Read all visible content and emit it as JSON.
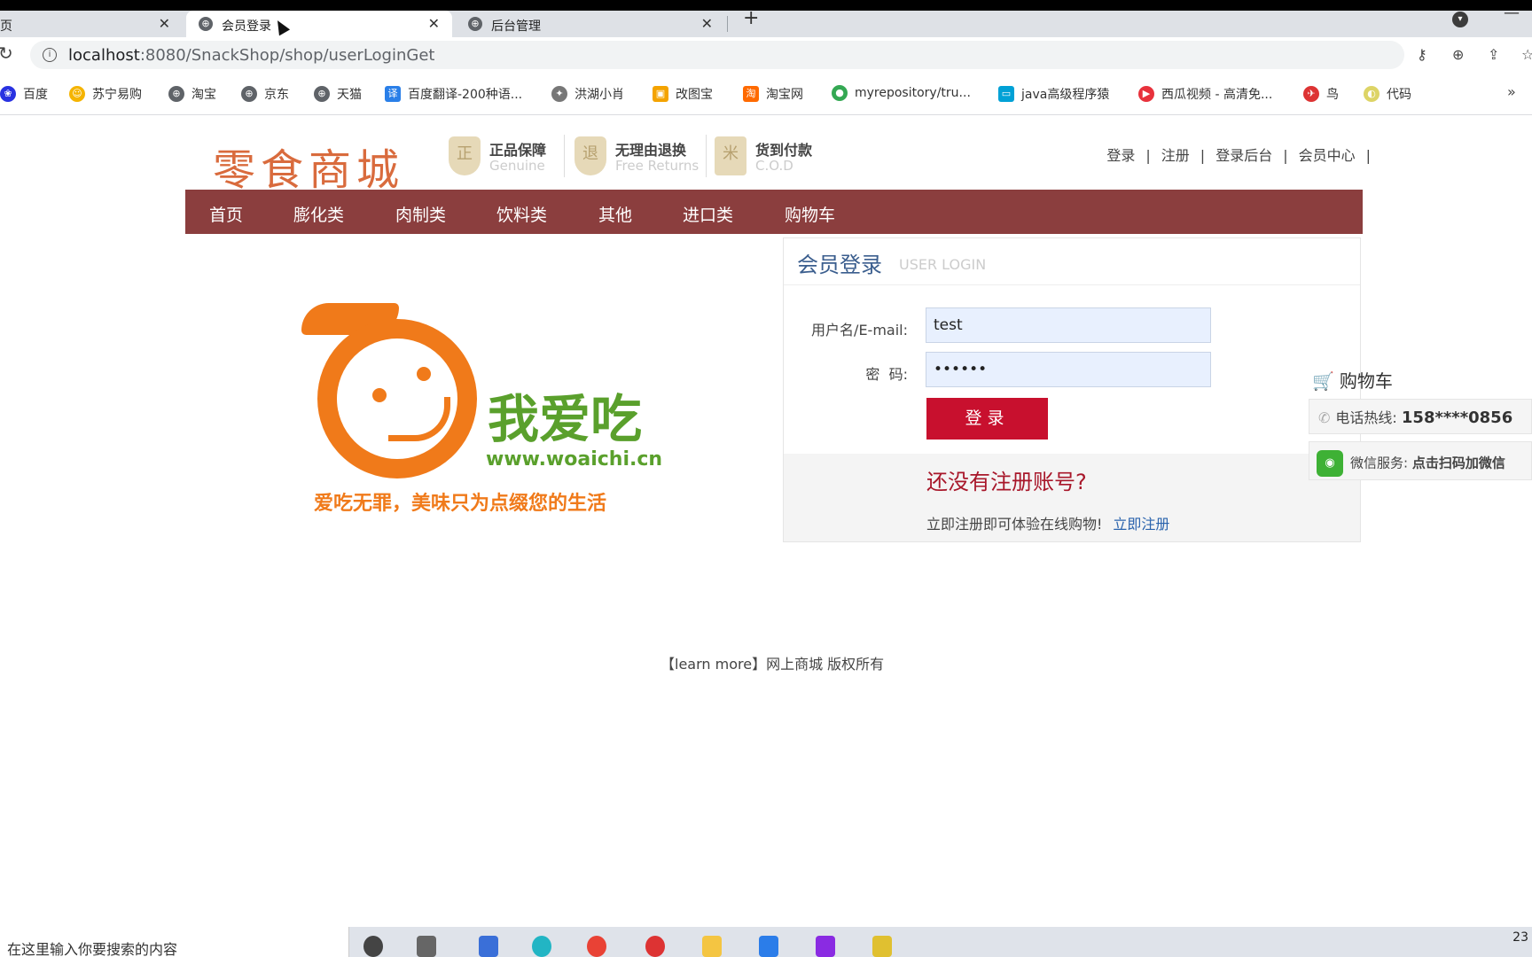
{
  "browser": {
    "tabs": [
      {
        "title": "页",
        "active": false
      },
      {
        "title": "会员登录",
        "active": true
      },
      {
        "title": "后台管理",
        "active": false
      }
    ],
    "url_host": "localhost",
    "url_path": ":8080/SnackShop/shop/userLoginGet",
    "bookmarks": [
      {
        "label": "百度",
        "icon": "baidu-icon",
        "color": "#2932e1"
      },
      {
        "label": "苏宁易购",
        "icon": "suning-icon",
        "color": "#f5b400"
      },
      {
        "label": "淘宝",
        "icon": "globe-icon",
        "color": "#5f6368"
      },
      {
        "label": "京东",
        "icon": "globe-icon",
        "color": "#5f6368"
      },
      {
        "label": "天猫",
        "icon": "globe-icon",
        "color": "#5f6368"
      },
      {
        "label": "百度翻译-200种语...",
        "icon": "translate-icon",
        "color": "#2a7fe8"
      },
      {
        "label": "洪湖小肖",
        "icon": "bird-icon",
        "color": "#777777"
      },
      {
        "label": "改图宝",
        "icon": "folder-icon",
        "color": "#f4a300"
      },
      {
        "label": "淘宝网",
        "icon": "taobao-icon",
        "color": "#ff6a00"
      },
      {
        "label": "myrepository/tru...",
        "icon": "chrome-icon",
        "color": "#34a853"
      },
      {
        "label": "java高级程序猿",
        "icon": "bilibili-icon",
        "color": "#00a1d6"
      },
      {
        "label": "西瓜视频 - 高清免...",
        "icon": "play-icon",
        "color": "#e8323c"
      },
      {
        "label": "鸟",
        "icon": "bird-red-icon",
        "color": "#d33"
      },
      {
        "label": "代码",
        "icon": "code-icon",
        "color": "#ddd466"
      }
    ]
  },
  "header": {
    "logo": "零食商城",
    "guarantees": [
      {
        "title": "正品保障",
        "sub": "Genuine",
        "icon_text": "正"
      },
      {
        "title": "无理由退换",
        "sub": "Free Returns",
        "icon_text": "退"
      },
      {
        "title": "货到付款",
        "sub": "C.O.D",
        "icon_text": "米"
      }
    ],
    "links": [
      "登录",
      "注册",
      "登录后台",
      "会员中心"
    ],
    "sep": "|"
  },
  "nav": [
    "首页",
    "膨化类",
    "肉制类",
    "饮料类",
    "其他",
    "进口类",
    "购物车"
  ],
  "banner": {
    "brand_cn": "我爱吃",
    "brand_url": "www.woaichi.cn",
    "slogan": "爱吃无罪，美味只为点缀您的生活"
  },
  "login": {
    "title": "会员登录",
    "subtitle": "USER LOGIN",
    "username_label": "用户名/E-mail:",
    "username_value": "test",
    "password_label": "密  码:",
    "password_value": "••••••",
    "submit_label": "登录",
    "register_question": "还没有注册账号?",
    "register_text": "立即注册即可体验在线购物!",
    "register_link": "立即注册"
  },
  "float": {
    "cart": "购物车",
    "hotline_label": "电话热线:",
    "hotline_number": "158****0856",
    "wechat_label": "微信服务:",
    "wechat_text": "点击扫码加微信"
  },
  "footer": "【learn more】网上商城 版权所有",
  "taskbar": {
    "search_text": "在这里输入你要搜索的内容",
    "time": "23"
  }
}
